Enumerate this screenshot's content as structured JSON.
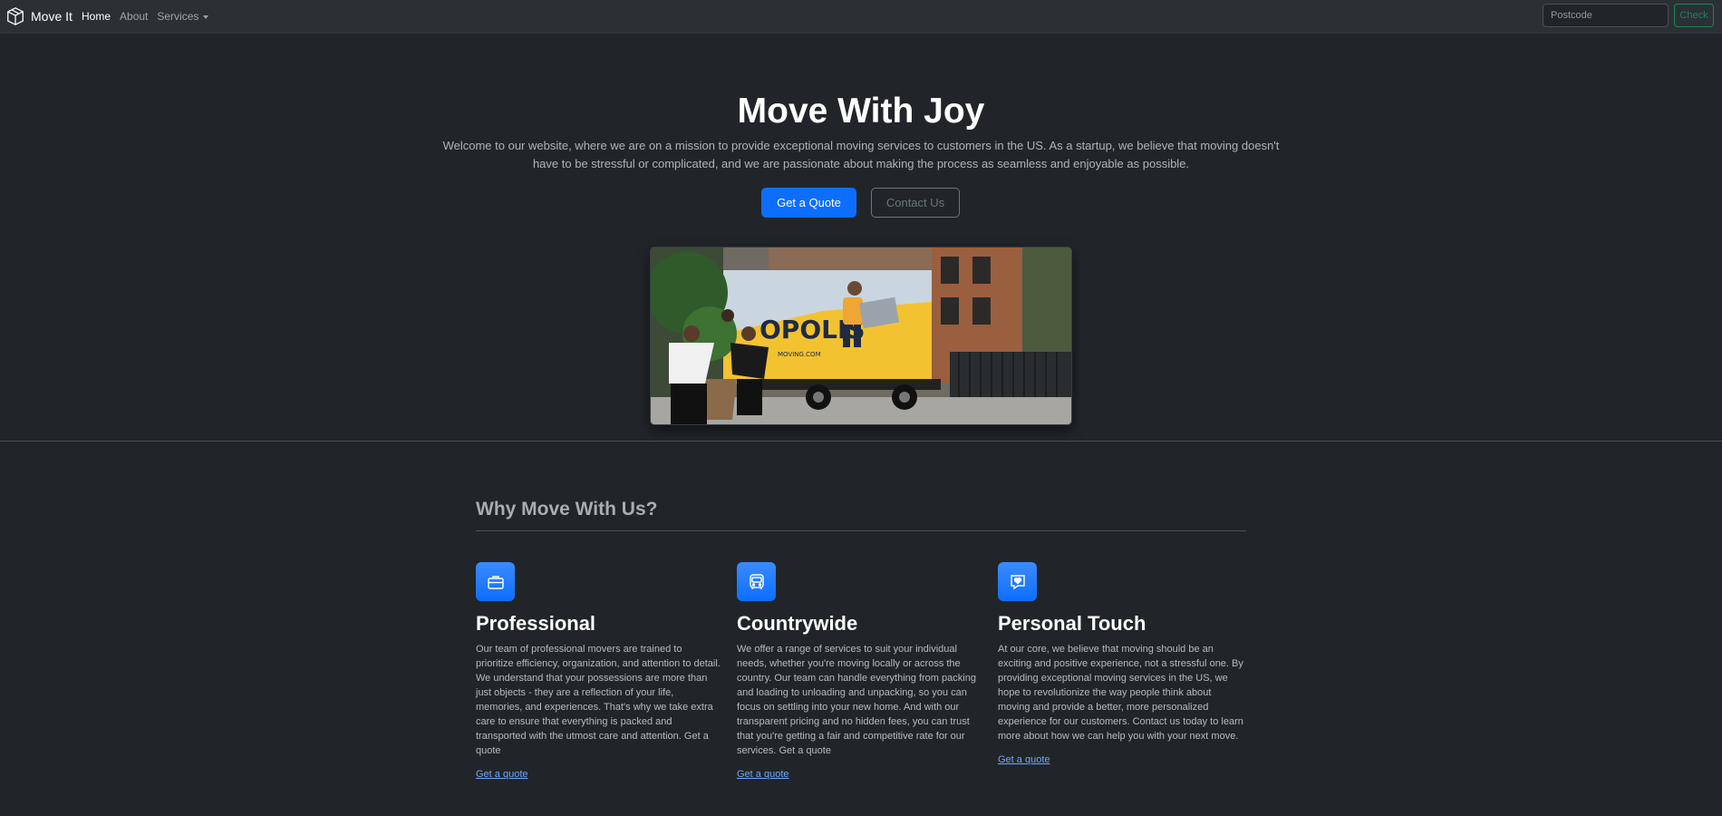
{
  "navbar": {
    "brand": "Move It",
    "brand_icon": "box-icon",
    "links": [
      {
        "label": "Home",
        "active": true
      },
      {
        "label": "About",
        "active": false
      },
      {
        "label": "Services",
        "active": false,
        "dropdown": true
      }
    ],
    "postcode_placeholder": "Postcode",
    "check_label": "Check"
  },
  "hero": {
    "title": "Move With Joy",
    "lead": "Welcome to our website, where we are on a mission to provide exceptional moving services to customers in the US. As a startup, we believe that moving doesn't have to be stressful or complicated, and we are passionate about making the process as seamless and enjoyable as possible.",
    "primary_button": "Get a Quote",
    "secondary_button": "Contact Us",
    "truck_text": "OPOLIS",
    "truck_small_text": "MOVING.COM"
  },
  "features": {
    "title": "Why Move With Us?",
    "items": [
      {
        "icon": "briefcase-icon",
        "title": "Professional",
        "text": "Our team of professional movers are trained to prioritize efficiency, organization, and attention to detail. We understand that your possessions are more than just objects - they are a reflection of your life, memories, and experiences. That's why we take extra care to ensure that everything is packed and transported with the utmost care and attention. Get a quote",
        "link": "Get a quote"
      },
      {
        "icon": "bus-icon",
        "title": "Countrywide",
        "text": "We offer a range of services to suit your individual needs, whether you're moving locally or across the country. Our team can handle everything from packing and loading to unloading and unpacking, so you can focus on settling into your new home. And with our transparent pricing and no hidden fees, you can trust that you're getting a fair and competitive rate for our services. Get a quote",
        "link": "Get a quote"
      },
      {
        "icon": "chat-heart-icon",
        "title": "Personal Touch",
        "text": "At our core, we believe that moving should be an exciting and positive experience, not a stressful one. By providing exceptional moving services in the US, we hope to revolutionize the way people think about moving and provide a better, more personalized experience for our customers. Contact us today to learn more about how we can help you with your next move.",
        "link": "Get a quote"
      }
    ]
  },
  "colors": {
    "background": "#212529",
    "navbar": "#2b3035",
    "primary": "#0d6efd",
    "success": "#198754",
    "link": "#6ea8fe"
  }
}
